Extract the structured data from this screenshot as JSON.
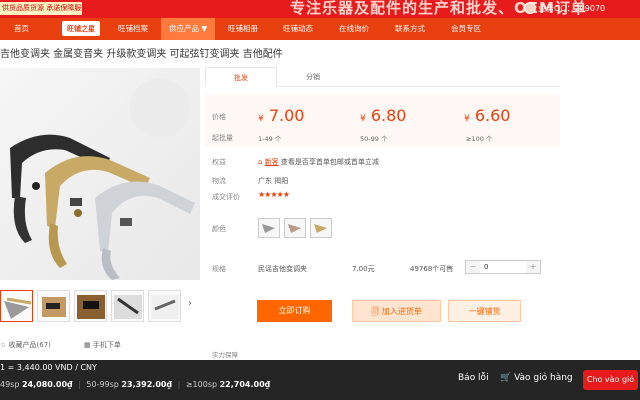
{
  "banner": {
    "promo": "供货品质货源 承诺保障服务",
    "slogan": "专注乐器及配件的生产和批发、OEM订单",
    "qq": "业务QQ：209070"
  },
  "nav": {
    "badge": "旺铺之星",
    "items": [
      "首页",
      "旺铺档案",
      "供应产品 ▼",
      "旺铺相册",
      "旺铺动态",
      "在线询价",
      "联系方式",
      "会员专区"
    ]
  },
  "product": {
    "title": "吉他变调夹 金属变音夹 升级款变调夹 可起弦钉变调夹 吉他配件"
  },
  "tabs": [
    "批发",
    "分销"
  ],
  "pricing": {
    "price_label": "价格",
    "qty_label": "起批量",
    "tiers": [
      {
        "price": "7.00",
        "qty": "1-49 个"
      },
      {
        "price": "6.80",
        "qty": "50-99 个"
      },
      {
        "price": "6.60",
        "qty": "≥100 个"
      }
    ],
    "currency": "¥"
  },
  "details": {
    "rights_label": "权益",
    "rights_text": "查看是否享首单包邮或首单立减",
    "rights_tag": "新客",
    "ship_label": "物流",
    "ship_text": "广东 揭阳",
    "rating_label": "成交评价",
    "stars": "★★★★★",
    "color_label": "颜色",
    "spec_label": "规格",
    "spec_name": "民谣吉他变调夹",
    "spec_price": "7.00元",
    "spec_stock": "49768个可售",
    "qty_value": "0"
  },
  "buttons": {
    "buy": "立即订购",
    "cart": "加入进货单",
    "shop": "一键铺货"
  },
  "gallery": {
    "collect": "收藏产品(67)",
    "mobile": "手机下单"
  },
  "warranty_text": "实力保障",
  "bottom": {
    "rate": "1 = 3,440.00 VND / CNY",
    "t1_label": "49sp",
    "t1_price": "24,080.00₫",
    "t2_label": "50-99sp",
    "t2_price": "23,392.00₫",
    "t3_label": "≥100sp",
    "t3_price": "22,704.00₫",
    "report": "Báo lỗi",
    "cart": "Vào giỏ hàng",
    "add": "Cho vào giỏ"
  }
}
